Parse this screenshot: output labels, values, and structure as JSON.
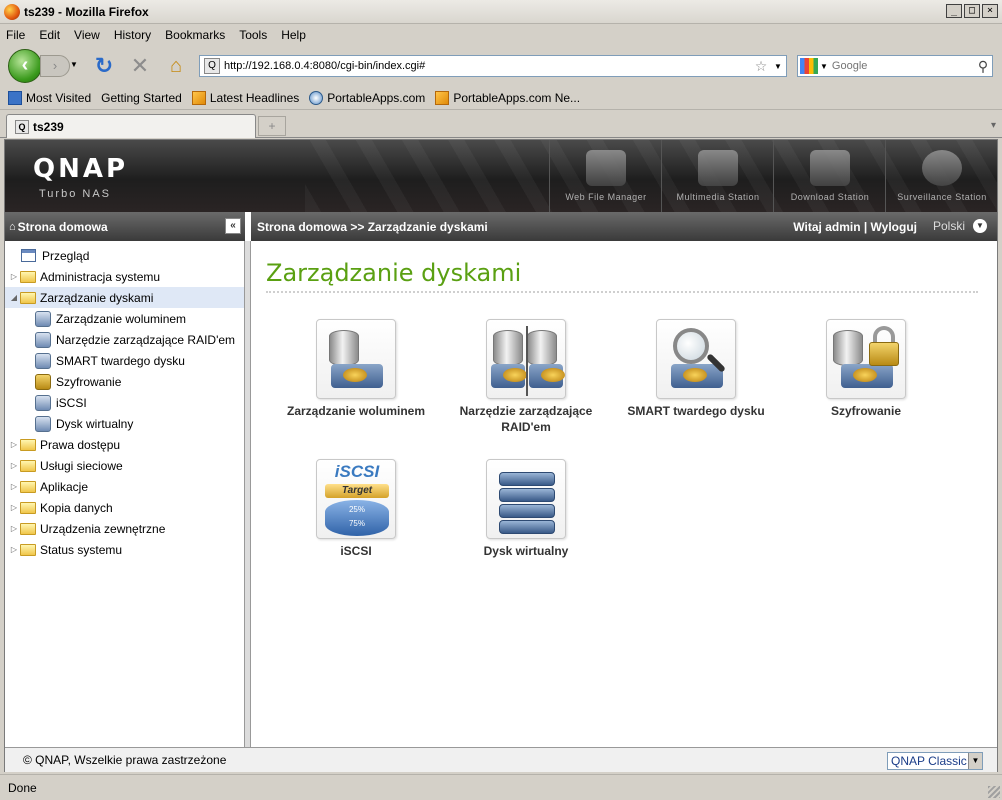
{
  "window": {
    "title": "ts239 - Mozilla Firefox",
    "min": "_",
    "max": "□",
    "close": "×"
  },
  "menu": [
    "File",
    "Edit",
    "View",
    "History",
    "Bookmarks",
    "Tools",
    "Help"
  ],
  "nav": {
    "url": "http://192.168.0.4:8080/cgi-bin/index.cgi#",
    "search_placeholder": "Google"
  },
  "bookmarks": [
    "Most Visited",
    "Getting Started",
    "Latest Headlines",
    "PortableApps.com",
    "PortableApps.com Ne..."
  ],
  "tab": {
    "title": "ts239"
  },
  "qnap": {
    "logo": "QNAP",
    "subtitle": "Turbo NAS",
    "apps": [
      "Web File Manager",
      "Multimedia Station",
      "Download Station",
      "Surveillance Station"
    ]
  },
  "sidebar": {
    "title": "Strona domowa",
    "items": [
      "Przegląd",
      "Administracja systemu",
      "Zarządzanie dyskami",
      "Zarządzanie woluminem",
      "Narzędzie zarządzające RAID'em",
      "SMART twardego dysku",
      "Szyfrowanie",
      "iSCSI",
      "Dysk wirtualny",
      "Prawa dostępu",
      "Usługi sieciowe",
      "Aplikacje",
      "Kopia danych",
      "Urządzenia zewnętrzne",
      "Status systemu"
    ]
  },
  "header": {
    "breadcrumb": "Strona domowa >> Zarządzanie dyskami",
    "welcome": "Witaj admin | Wyloguj",
    "language": "Polski"
  },
  "main": {
    "title": "Zarządzanie dyskami",
    "tiles": [
      "Zarządzanie woluminem",
      "Narzędzie zarządzające RAID'em",
      "SMART twardego dysku",
      "Szyfrowanie",
      "iSCSI",
      "Dysk wirtualny"
    ],
    "iscsi_icon": {
      "word": "iSCSI",
      "target": "Target",
      "p1": "25%",
      "p2": "75%"
    }
  },
  "footer": {
    "copyright": "© QNAP, Wszelkie prawa zastrzeżone",
    "theme": "QNAP Classic"
  },
  "status": "Done"
}
